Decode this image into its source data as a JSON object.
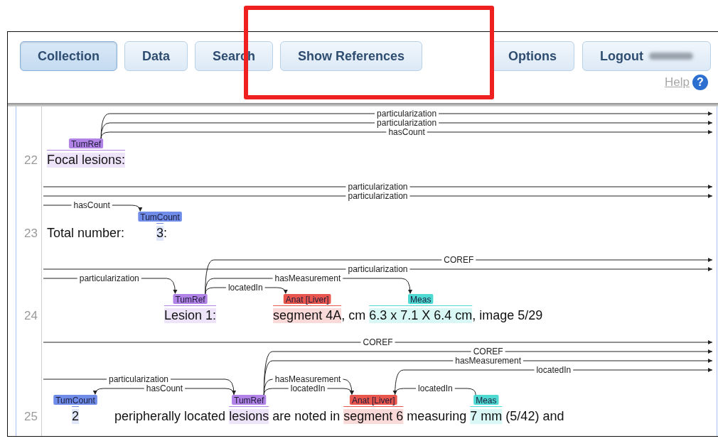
{
  "overlay": {
    "kind": "highlight-rectangle"
  },
  "toolbar": {
    "left": [
      {
        "label": "Collection",
        "selected": true
      },
      {
        "label": "Data",
        "selected": false
      },
      {
        "label": "Search",
        "selected": false
      },
      {
        "label": "Show References",
        "selected": false
      }
    ],
    "right": [
      {
        "label": "Options",
        "selected": false,
        "redacted": false
      },
      {
        "label": "Logout",
        "selected": false,
        "redacted": true
      }
    ]
  },
  "help": {
    "label": "Help",
    "icon": "?"
  },
  "rows": [
    {
      "number": "22",
      "segments": [
        {
          "text": "Focal lesions:",
          "label": "TumRef",
          "color": "#b283e6"
        }
      ],
      "tiers": [
        [
          {
            "label": "particularization",
            "kind": "first-right"
          }
        ],
        [
          {
            "label": "particularization",
            "kind": "first-right"
          }
        ],
        [
          {
            "label": "hasCount",
            "kind": "first-right"
          }
        ]
      ]
    },
    {
      "number": "23",
      "segments": [
        {
          "text": "Total number:         "
        },
        {
          "text": "3",
          "label": "TumCount",
          "color": "#6f8ce8"
        },
        {
          "text": ":"
        }
      ],
      "tiers": [
        [
          {
            "label": "particularization",
            "kind": "left-right"
          }
        ],
        [
          {
            "label": "particularization",
            "kind": "left-right"
          }
        ],
        [
          {
            "label": "hasCount",
            "kind": "left-first"
          }
        ]
      ]
    },
    {
      "number": "24",
      "segments": [
        {
          "text": "                                 Lesion 1:",
          "label": "TumRef",
          "color": "#b283e6"
        },
        {
          "text": "                segment 4A",
          "label": "Anat [Liver]",
          "color": "#e8564d"
        },
        {
          "text": ", cm "
        },
        {
          "text": "6.3 x 7.1 X 6.4 cm",
          "label": "Meas",
          "color": "#4fd9d3"
        },
        {
          "text": ", image 5/29"
        }
      ],
      "tiers": [
        [
          {
            "label": "COREF",
            "kind": "first-right"
          }
        ],
        [
          {
            "label": "particularization",
            "kind": "left-right"
          }
        ],
        [
          {
            "label": "particularization",
            "kind": "left-first"
          },
          {
            "label": "hasMeasurement",
            "kind": "first-third"
          }
        ],
        [
          {
            "label": "locatedIn",
            "kind": "first-second"
          }
        ]
      ]
    },
    {
      "number": "25",
      "segments": [
        {
          "text": "       2",
          "label": "TumCount",
          "color": "#6f8ce8"
        },
        {
          "text": "          peripherally located "
        },
        {
          "text": "lesions",
          "label": "TumRef",
          "color": "#b283e6"
        },
        {
          "text": " are noted in "
        },
        {
          "text": "segment 6",
          "label": "Anat [Liver]",
          "color": "#e8564d"
        },
        {
          "text": " measuring "
        },
        {
          "text": "7 mm",
          "label": "Meas",
          "color": "#4fd9d3"
        },
        {
          "text": " (5/42) and"
        }
      ],
      "tiers": [
        [
          {
            "label": "COREF",
            "kind": "left-right"
          }
        ],
        [
          {
            "label": "COREF",
            "kind": "second-right"
          }
        ],
        [
          {
            "label": "hasMeasurement",
            "kind": "second-right"
          }
        ],
        [
          {
            "label": "locatedIn",
            "kind": "third-right"
          }
        ],
        [
          {
            "label": "particularization",
            "kind": "left-second"
          },
          {
            "label": "hasMeasurement",
            "kind": "second-third"
          }
        ],
        [
          {
            "label": "hasCount",
            "kind": "second-first"
          },
          {
            "label": "locatedIn",
            "kind": "second-third"
          },
          {
            "label": "locatedIn",
            "kind": "fourth-third"
          }
        ]
      ]
    }
  ]
}
